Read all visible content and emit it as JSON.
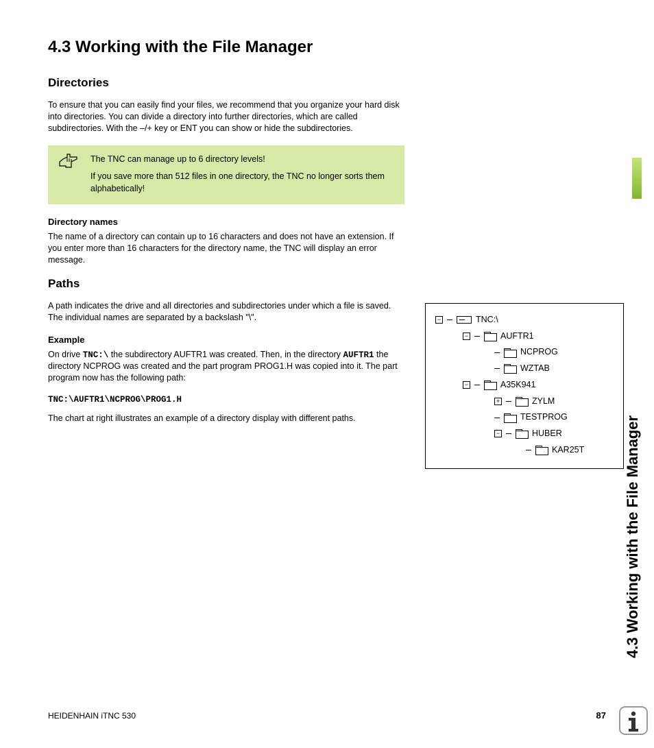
{
  "sideTab": "4.3 Working with the File Manager",
  "title": "4.3  Working with the File Manager",
  "directories": {
    "heading": "Directories",
    "intro": "To ensure that you can easily find your files, we recommend that you organize your hard disk into directories. You can divide a directory into further directories, which are called subdirectories. With the –/+ key or ENT you can show or hide the subdirectories.",
    "note1": "The TNC can manage up to 6 directory levels!",
    "note2": "If you save more than 512 files in one directory, the TNC no longer sorts them alphabetically!",
    "namesHeading": "Directory names",
    "namesText": "The name of a directory can contain up to 16 characters and does not have an extension. If you enter more than 16 characters for the directory name, the TNC will display an error message."
  },
  "paths": {
    "heading": "Paths",
    "intro": "A path indicates the drive and all directories and subdirectories under which a file is saved. The individual names are separated by a backslash \"\\\".",
    "exampleHeading": "Example",
    "examplePre": "On drive ",
    "exampleDrive": "TNC:\\",
    "exampleMid1": " the subdirectory AUFTR1 was created. Then, in the directory ",
    "exampleDir": "AUFTR1",
    "exampleMid2": " the directory NCPROG was created and the part program PROG1.H was copied into it. The part program now has the following path:",
    "pathLine": "TNC:\\AUFTR1\\NCPROG\\PROG1.H",
    "chartNote": "The chart at right illustrates an example of a directory display with different paths."
  },
  "tree": {
    "root": "TNC:\\",
    "n1": "AUFTR1",
    "n1a": "NCPROG",
    "n1b": "WZTAB",
    "n2": "A35K941",
    "n2a": "ZYLM",
    "n2b": "TESTPROG",
    "n2c": "HUBER",
    "n2c1": "KAR25T"
  },
  "footer": {
    "product": "HEIDENHAIN iTNC 530",
    "page": "87"
  }
}
